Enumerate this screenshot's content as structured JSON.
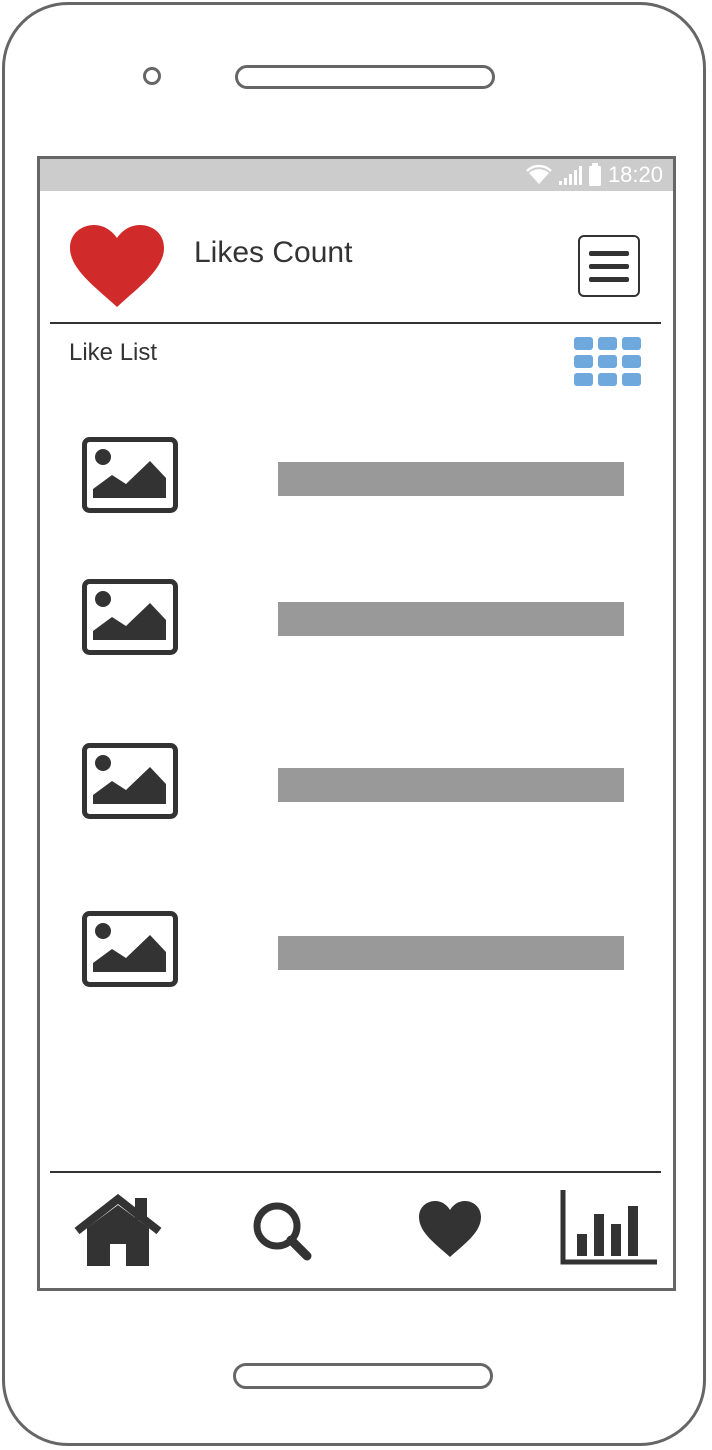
{
  "status_bar": {
    "time": "18:20",
    "icons": [
      "wifi-icon",
      "signal-icon",
      "battery-icon"
    ]
  },
  "header": {
    "logo_icon": "heart-icon",
    "title": "Likes Count",
    "menu_icon": "hamburger-menu-icon"
  },
  "section": {
    "title": "Like List",
    "view_toggle_icon": "grid-view-icon"
  },
  "list": {
    "items": [
      {
        "thumbnail_icon": "image-placeholder-icon",
        "text": ""
      },
      {
        "thumbnail_icon": "image-placeholder-icon",
        "text": ""
      },
      {
        "thumbnail_icon": "image-placeholder-icon",
        "text": ""
      },
      {
        "thumbnail_icon": "image-placeholder-icon",
        "text": ""
      }
    ]
  },
  "bottom_nav": {
    "items": [
      "home-icon",
      "search-icon",
      "heart-icon",
      "bar-chart-icon"
    ]
  },
  "colors": {
    "status_bar": "#cccccc",
    "heart_logo": "#d12a2a",
    "grid_icon": "#6fa8dc",
    "text_placeholder": "#999999",
    "icon_dark": "#333333"
  }
}
